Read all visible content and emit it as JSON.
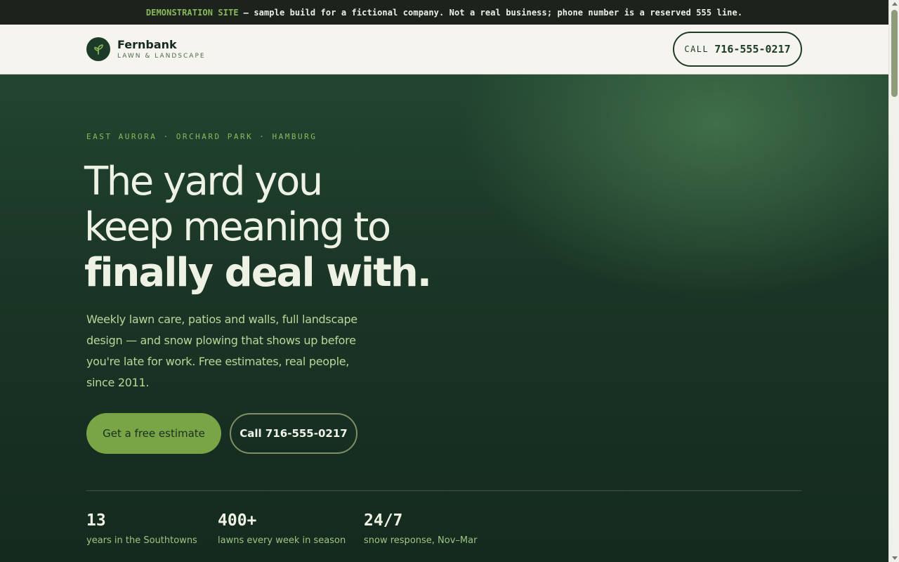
{
  "banner": {
    "tag": "DEMONSTRATION SITE",
    "text": "— sample build for a fictional company. Not a real business; phone number is a reserved 555 line."
  },
  "header": {
    "brand_name": "Fernbank",
    "brand_sub": "LAWN & LANDSCAPE",
    "logo_icon": "leaf-icon",
    "call_label": "CALL",
    "call_number": "716-555-0217"
  },
  "hero": {
    "eyebrow": "EAST AURORA · ORCHARD PARK · HAMBURG",
    "headline_line1": "The yard you",
    "headline_line2": "keep meaning to",
    "headline_line3": "finally deal with.",
    "lede": "Weekly lawn care, patios and walls, full landscape design — and snow plowing that shows up before you're late for work. Free estimates, real people, since 2011.",
    "primary_cta": "Get a free estimate",
    "secondary_cta": "Call 716-555-0217"
  },
  "stats": [
    {
      "value": "13",
      "caption": "years in the Southtowns"
    },
    {
      "value": "400+",
      "caption": "lawns every week in season"
    },
    {
      "value": "24/7",
      "caption": "snow response, Nov–Mar"
    }
  ],
  "colors": {
    "accent": "#79a547",
    "dark_green": "#1d3b29",
    "cream": "#f6f4ee"
  }
}
